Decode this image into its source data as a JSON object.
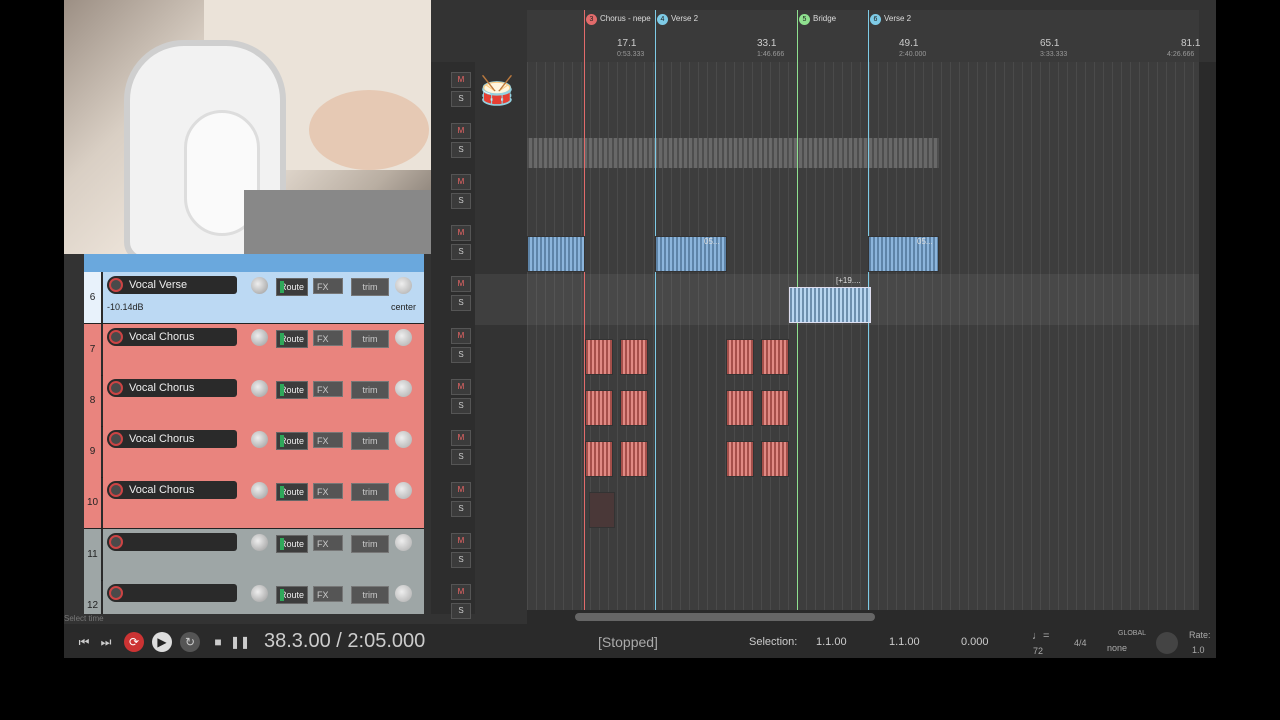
{
  "ruler": {
    "markers": [
      {
        "num": "3",
        "label": "Chorus - nepe",
        "color": "#e26b6b"
      },
      {
        "num": "4",
        "label": "Verse 2",
        "color": "#7ecbe6"
      },
      {
        "num": "5",
        "label": "Bridge",
        "color": "#8fe08f"
      },
      {
        "num": "6",
        "label": "Verse 2",
        "color": "#7ecbe6"
      }
    ],
    "bars": [
      "17.1",
      "33.1",
      "49.1",
      "65.1",
      "81.1"
    ],
    "times": [
      "0:53.333",
      "1:46.666",
      "2:40.000",
      "3:33.333",
      "4:26.666"
    ]
  },
  "tracks": [
    {
      "num": "6",
      "name": "Vocal Verse",
      "db": "-10.14dB",
      "pan": "center",
      "color": "blue"
    },
    {
      "num": "7",
      "name": "Vocal Chorus",
      "color": "red"
    },
    {
      "num": "8",
      "name": "Vocal Chorus",
      "color": "red"
    },
    {
      "num": "9",
      "name": "Vocal Chorus",
      "color": "red"
    },
    {
      "num": "10",
      "name": "Vocal Chorus",
      "color": "red"
    },
    {
      "num": "11",
      "name": "",
      "color": "grey"
    },
    {
      "num": "12",
      "name": "",
      "color": "grey"
    }
  ],
  "buttons": {
    "route": "Route",
    "fx": "FX",
    "trim": "trim",
    "mute": "M",
    "solo": "S"
  },
  "items": {
    "label_a": "05...",
    "label_b": "05...",
    "label_c": "[+19...."
  },
  "transport": {
    "position": "38.3.00 / 2:05.000",
    "state": "[Stopped]",
    "selection_label": "Selection:",
    "sel_start": "1.1.00",
    "sel_end": "1.1.00",
    "sel_len": "0.000",
    "bpm": "72",
    "timesig": "4/4",
    "global_label": "GLOBAL",
    "global_value": "none",
    "rate_label": "Rate:",
    "rate_value": "1.0",
    "hint": "Select time"
  }
}
